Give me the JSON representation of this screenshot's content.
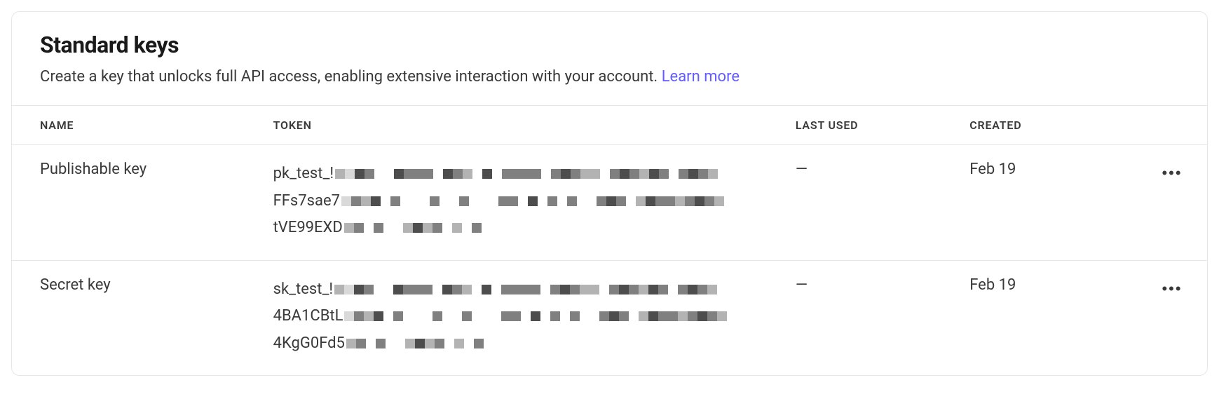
{
  "header": {
    "title": "Standard keys",
    "subtitle": "Create a key that unlocks full API access, enabling extensive interaction with your account. ",
    "learn_more": "Learn more"
  },
  "columns": {
    "name": "NAME",
    "token": "TOKEN",
    "last_used": "LAST USED",
    "created": "CREATED"
  },
  "rows": [
    {
      "name": "Publishable key",
      "token_lines": [
        "pk_test_!",
        "FFs7sae7",
        "tVE99EXD"
      ],
      "last_used": "—",
      "created": "Feb 19"
    },
    {
      "name": "Secret key",
      "token_lines": [
        "sk_test_!",
        "4BA1CBtL",
        "4KgG0Fd5"
      ],
      "last_used": "—",
      "created": "Feb 19"
    }
  ],
  "icons": {
    "more": "•••"
  },
  "pixel_masks": {
    "long": [
      [
        3,
        2,
        5,
        4,
        0,
        0,
        5,
        4,
        4,
        4,
        0,
        5,
        4,
        3,
        0,
        5,
        0,
        4,
        4,
        4,
        4,
        0,
        4,
        5,
        4,
        3,
        3,
        0,
        4,
        5,
        4,
        3,
        5,
        4,
        0,
        4,
        5,
        4,
        3
      ],
      [
        2,
        4,
        3,
        5,
        0,
        4,
        0,
        0,
        0,
        4,
        0,
        0,
        4,
        0,
        0,
        0,
        4,
        4,
        0,
        5,
        0,
        4,
        0,
        4,
        0,
        0,
        4,
        5,
        4,
        0,
        3,
        5,
        4,
        4,
        3,
        4,
        5,
        4,
        3
      ]
    ],
    "short": [
      [
        3,
        4,
        0,
        4,
        0,
        0,
        3,
        5,
        3,
        4,
        0,
        3,
        0,
        4
      ]
    ]
  }
}
